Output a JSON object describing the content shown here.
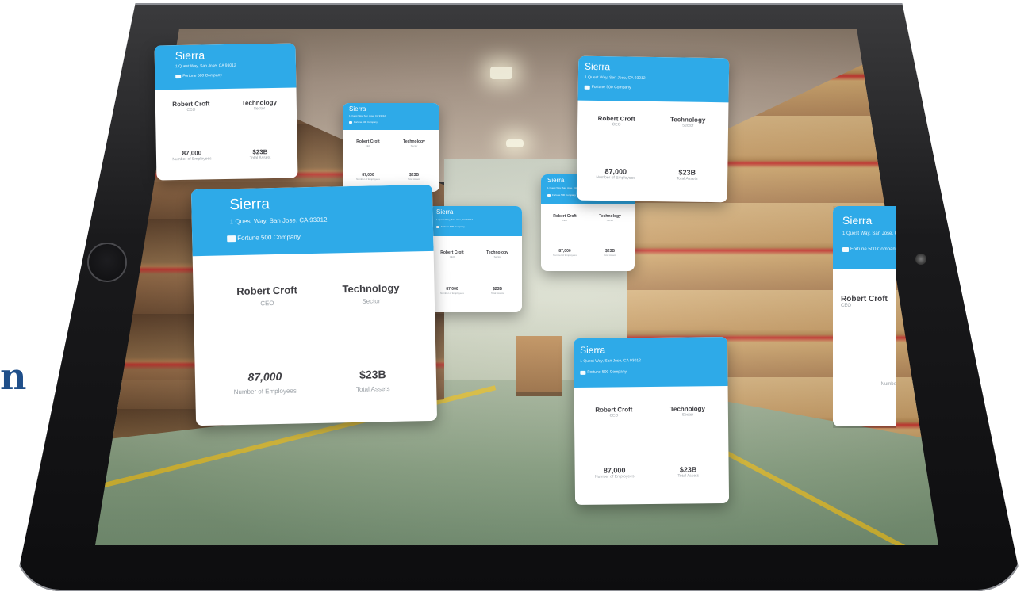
{
  "edge_text": "n",
  "card": {
    "name": "Sierra",
    "address": "1 Quest Way, San Jose, CA 93012",
    "badge": "Fortune 500 Company",
    "person": "Robert Croft",
    "role": "CEO",
    "sector_value": "Technology",
    "sector_label": "Sector",
    "employees": "87,000",
    "employees_label": "Number of Employees",
    "assets": "$23B",
    "assets_label": "Total Assets"
  },
  "colors": {
    "card_header": "#2eaae8",
    "card_body": "#ffffff",
    "brand_blue_text": "#1f4f8a"
  },
  "icons": [
    "folder-icon"
  ]
}
